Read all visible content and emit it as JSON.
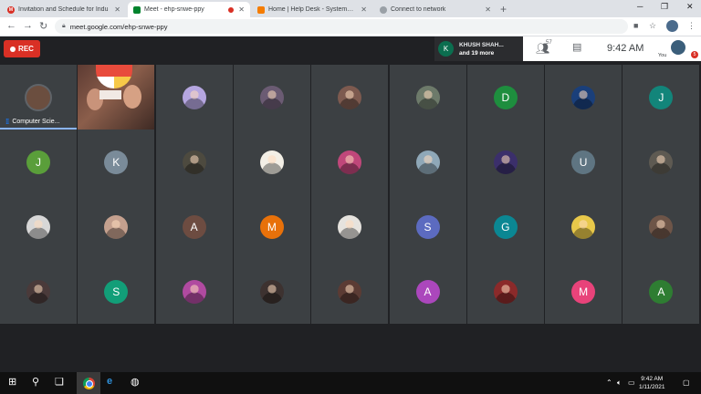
{
  "browser": {
    "tabs": [
      {
        "title": "Invitation and Schedule for Indu",
        "favicon": "gmail-icon",
        "favicon_color": "#d93025",
        "favicon_letter": "M"
      },
      {
        "title": "Meet - ehp-snwe-ppy",
        "favicon": "meet-icon",
        "favicon_color": "#00832d",
        "favicon_letter": "",
        "active": true
      },
      {
        "title": "Home | Help Desk - Systems De",
        "favicon": "helpdesk-icon",
        "favicon_color": "#f57c00",
        "favicon_letter": ""
      },
      {
        "title": "Connect to network",
        "favicon": "globe-icon",
        "favicon_color": "#9aa0a6",
        "favicon_letter": ""
      }
    ],
    "new_tab_label": "+",
    "url": "meet.google.com/ehp-snwe-ppy"
  },
  "meet": {
    "rec_label": "REC",
    "speaker": {
      "initial": "K",
      "name": "KHUSH SHAH...",
      "more": "and 19 more"
    },
    "participant_count": "57",
    "time": "9:42 AM",
    "you_label": "You",
    "notification_count": "5",
    "self_tile_label": "Computer Scie...",
    "tiles": [
      [
        {
          "type": "self"
        },
        {
          "type": "video"
        },
        {
          "type": "photo",
          "color": "#b5a6e0"
        },
        {
          "type": "photo",
          "color": "#6b5b73"
        },
        {
          "type": "photo",
          "color": "#7d5a4f"
        },
        {
          "type": "photo",
          "color": "#6d7a6a"
        },
        {
          "type": "letter",
          "letter": "D",
          "color": "#1e8e3e"
        },
        {
          "type": "photo",
          "color": "#1a3f7a"
        },
        {
          "type": "letter",
          "letter": "J",
          "color": "#12857a"
        }
      ],
      [
        {
          "type": "letter",
          "letter": "J",
          "color": "#5a9e3a"
        },
        {
          "type": "letter",
          "letter": "K",
          "color": "#7a8b99"
        },
        {
          "type": "photo",
          "color": "#4d4a3f"
        },
        {
          "type": "photo",
          "color": "#f3efe6"
        },
        {
          "type": "photo",
          "color": "#c0477a"
        },
        {
          "type": "photo",
          "color": "#8fa8b8"
        },
        {
          "type": "photo",
          "color": "#3b2f6b"
        },
        {
          "type": "letter",
          "letter": "U",
          "color": "#5f7582"
        },
        {
          "type": "photo",
          "color": "#5e5a52"
        }
      ],
      [
        {
          "type": "photo",
          "color": "#d7d7d7"
        },
        {
          "type": "photo",
          "color": "#c4a08e"
        },
        {
          "type": "letter",
          "letter": "A",
          "color": "#6d4c41"
        },
        {
          "type": "letter",
          "letter": "M",
          "color": "#e8710a"
        },
        {
          "type": "photo",
          "color": "#e6e3de"
        },
        {
          "type": "letter",
          "letter": "S",
          "color": "#5c6bc0"
        },
        {
          "type": "letter",
          "letter": "G",
          "color": "#0b8793"
        },
        {
          "type": "photo",
          "color": "#e8c84a"
        },
        {
          "type": "photo",
          "color": "#6e5548"
        }
      ],
      [
        {
          "type": "photo",
          "color": "#4a3a3a"
        },
        {
          "type": "letter",
          "letter": "S",
          "color": "#129e78"
        },
        {
          "type": "photo",
          "color": "#b04aa0"
        },
        {
          "type": "photo",
          "color": "#3d3230"
        },
        {
          "type": "photo",
          "color": "#5b3b34"
        },
        {
          "type": "letter",
          "letter": "A",
          "color": "#ab47bc"
        },
        {
          "type": "photo",
          "color": "#8b2a2a"
        },
        {
          "type": "letter",
          "letter": "M",
          "color": "#e8437a"
        },
        {
          "type": "letter",
          "letter": "A",
          "color": "#2e7d32"
        }
      ]
    ]
  },
  "taskbar": {
    "time": "9:42 AM",
    "date": "1/11/2021"
  }
}
